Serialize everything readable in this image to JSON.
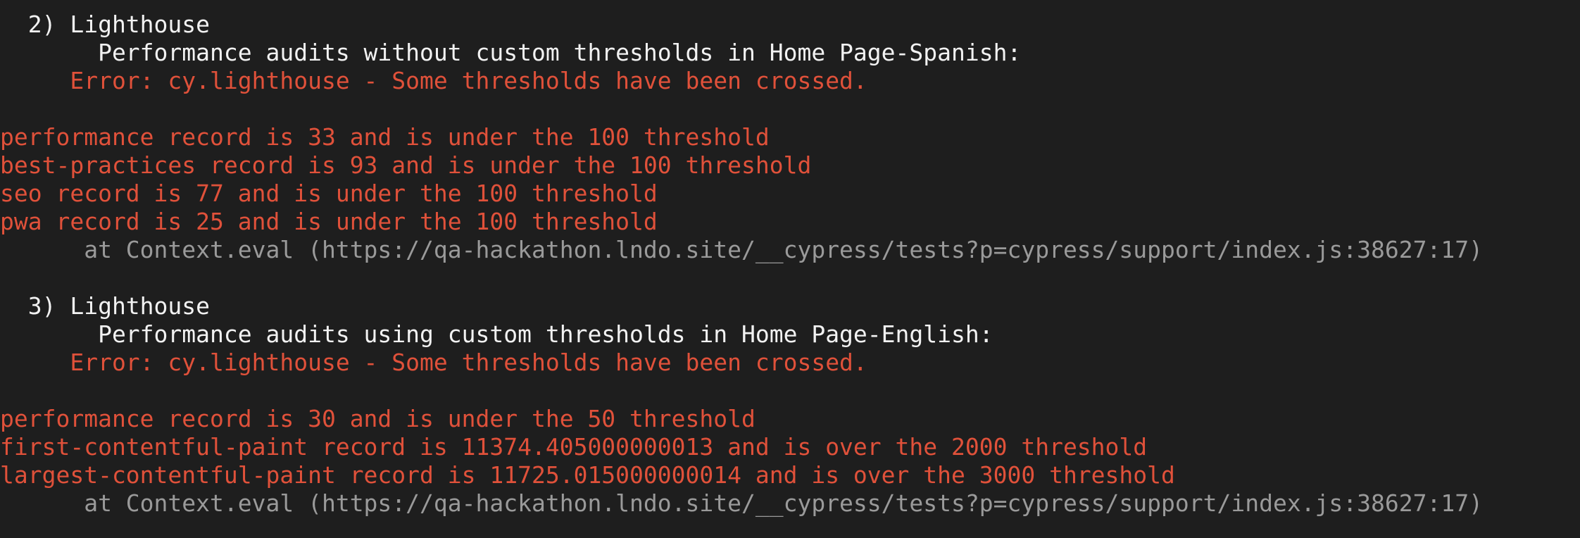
{
  "colors": {
    "background": "#1e1e1e",
    "title_text": "#f2f2f2",
    "error_text": "#e0513a",
    "stack_text": "#9a9a9a"
  },
  "failures": [
    {
      "heading": "  2) Lighthouse",
      "test_name": "       Performance audits without custom thresholds in Home Page-Spanish:",
      "error": "     Error: cy.lighthouse - Some thresholds have been crossed.",
      "records": [
        "performance record is 33 and is under the 100 threshold",
        "best-practices record is 93 and is under the 100 threshold",
        "seo record is 77 and is under the 100 threshold",
        "pwa record is 25 and is under the 100 threshold"
      ],
      "stack": "      at Context.eval (https://qa-hackathon.lndo.site/__cypress/tests?p=cypress/support/index.js:38627:17)"
    },
    {
      "heading": "  3) Lighthouse",
      "test_name": "       Performance audits using custom thresholds in Home Page-English:",
      "error": "     Error: cy.lighthouse - Some thresholds have been crossed.",
      "records": [
        "performance record is 30 and is under the 50 threshold",
        "first-contentful-paint record is 11374.405000000013 and is over the 2000 threshold",
        "largest-contentful-paint record is 11725.015000000014 and is over the 3000 threshold"
      ],
      "stack": "      at Context.eval (https://qa-hackathon.lndo.site/__cypress/tests?p=cypress/support/index.js:38627:17)"
    }
  ]
}
